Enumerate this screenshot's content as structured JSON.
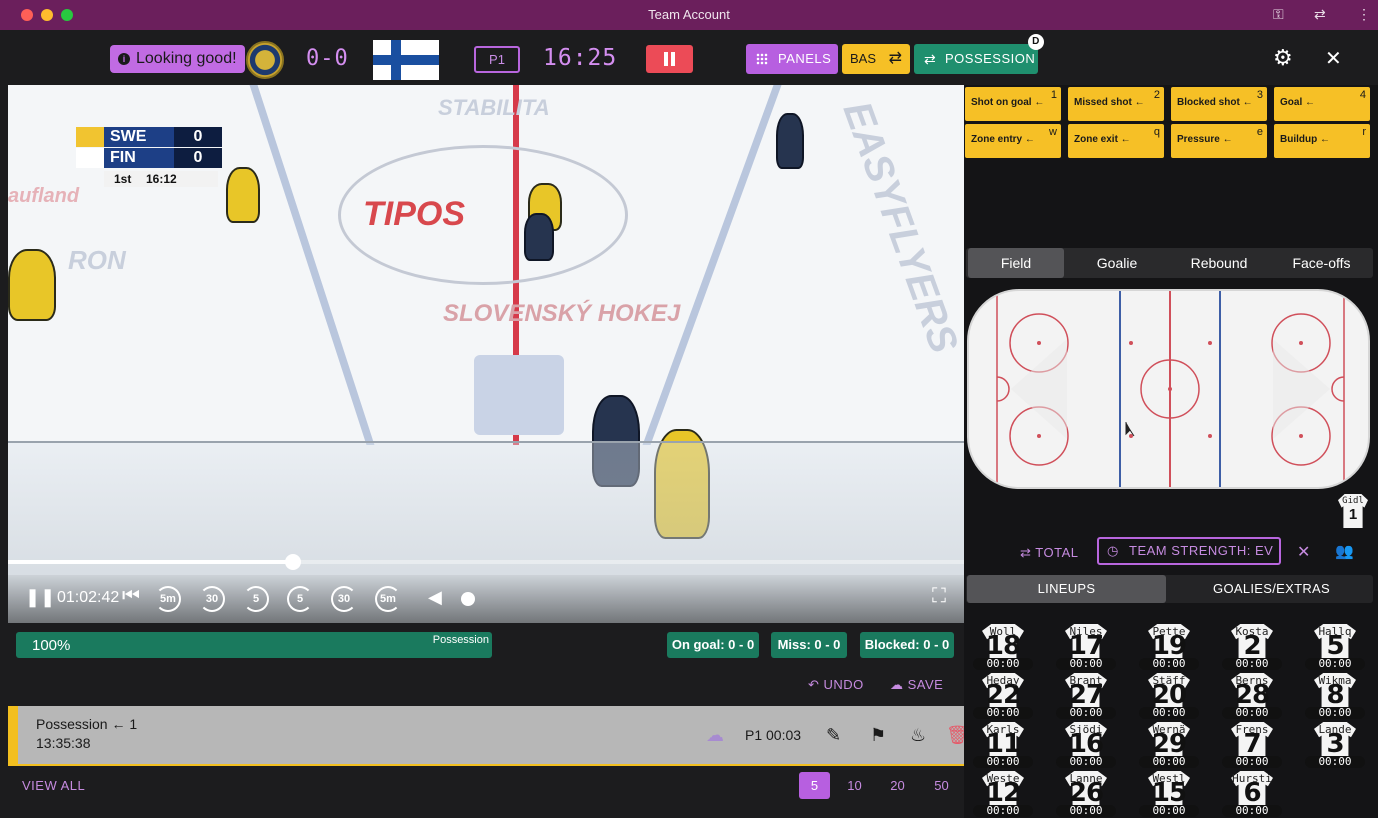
{
  "window": {
    "title": "Team Account"
  },
  "topbar": {
    "status": "Looking good!",
    "score": "0-0",
    "period": "P1",
    "clock": "16:25",
    "panels_label": "PANELS",
    "bas_label": "BAS",
    "possession_label": "POSSESSION",
    "possession_badge": "D"
  },
  "video": {
    "scoreboard": {
      "team1": "SWE",
      "score1": "0",
      "team2": "FIN",
      "score2": "0",
      "period": "1st",
      "time": "16:12"
    },
    "position": "01:02:42",
    "seek_progress": 0.298,
    "skips": [
      "5m",
      "30",
      "5",
      "5",
      "30",
      "5m"
    ]
  },
  "possession": {
    "percent": "100%",
    "label": "Possession"
  },
  "stats": {
    "on_goal": "On goal: 0 - 0",
    "miss": "Miss: 0 - 0",
    "blocked": "Blocked: 0 - 0"
  },
  "actions": {
    "undo": "UNDO",
    "save": "SAVE"
  },
  "event": {
    "name": "Possession ← 1",
    "time": "13:35:38",
    "period_time": "P1 00:03"
  },
  "footer": {
    "view_all": "VIEW ALL",
    "page_sizes": [
      "5",
      "10",
      "20",
      "50"
    ],
    "active_page_size": "5"
  },
  "event_buttons": [
    {
      "label": "Shot on goal ←",
      "key": "1"
    },
    {
      "label": "Missed shot ←",
      "key": "2"
    },
    {
      "label": "Blocked shot ←",
      "key": "3"
    },
    {
      "label": "Goal ←",
      "key": "4"
    },
    {
      "label": "Zone entry ←",
      "key": "w"
    },
    {
      "label": "Zone exit ←",
      "key": "q"
    },
    {
      "label": "Pressure ←",
      "key": "e"
    },
    {
      "label": "Buildup ←",
      "key": "r"
    }
  ],
  "tabs": [
    "Field",
    "Goalie",
    "Rebound",
    "Face-offs"
  ],
  "active_tab": "Field",
  "goalie": {
    "name": "Gidl",
    "number": "1"
  },
  "strength": {
    "total": "TOTAL",
    "team_strength": "TEAM STRENGTH: EV"
  },
  "lineup_tabs": [
    "LINEUPS",
    "GOALIES/EXTRAS"
  ],
  "lineup": [
    {
      "name": "Woll",
      "number": "18",
      "time": "00:00"
    },
    {
      "name": "Niles",
      "number": "17",
      "time": "00:00"
    },
    {
      "name": "Pette",
      "number": "19",
      "time": "00:00"
    },
    {
      "name": "Kosta",
      "number": "2",
      "time": "00:00"
    },
    {
      "name": "Hallq",
      "number": "5",
      "time": "00:00"
    },
    {
      "name": "Heday",
      "number": "22",
      "time": "00:00"
    },
    {
      "name": "Brant",
      "number": "27",
      "time": "00:00"
    },
    {
      "name": "Stäff",
      "number": "20",
      "time": "00:00"
    },
    {
      "name": "Berns",
      "number": "28",
      "time": "00:00"
    },
    {
      "name": "Wikma",
      "number": "8",
      "time": "00:00"
    },
    {
      "name": "Karls",
      "number": "11",
      "time": "00:00"
    },
    {
      "name": "Sjödi",
      "number": "16",
      "time": "00:00"
    },
    {
      "name": "Wernä",
      "number": "29",
      "time": "00:00"
    },
    {
      "name": "Frens",
      "number": "7",
      "time": "00:00"
    },
    {
      "name": "Lande",
      "number": "3",
      "time": "00:00"
    },
    {
      "name": "Weste",
      "number": "12",
      "time": "00:00"
    },
    {
      "name": "Lanne",
      "number": "26",
      "time": "00:00"
    },
    {
      "name": "Westl",
      "number": "15",
      "time": "00:00"
    },
    {
      "name": "Hursti",
      "number": "6",
      "time": "00:00"
    }
  ],
  "colors": {
    "accent": "#b75fe0",
    "event": "#f6c026",
    "possession": "#1a7a5e",
    "titlebar": "#6b1f5c"
  }
}
